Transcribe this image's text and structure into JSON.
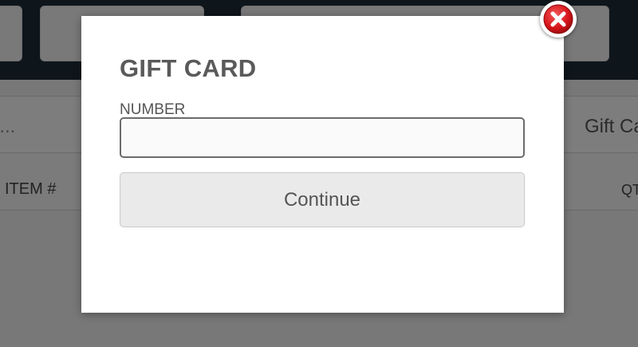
{
  "background": {
    "search_placeholder": "re...",
    "gift_card_tab": "Gift Ca",
    "columns": {
      "item": "ITEM #",
      "qty": "QT"
    }
  },
  "modal": {
    "title": "GIFT CARD",
    "number_label": "NUMBER",
    "number_value": "",
    "continue_label": "Continue",
    "close_icon": "close-icon"
  },
  "colors": {
    "topbar": "#1c2a36",
    "close_red": "#d7141a",
    "overlay": "rgba(0,0,0,0.5)"
  }
}
